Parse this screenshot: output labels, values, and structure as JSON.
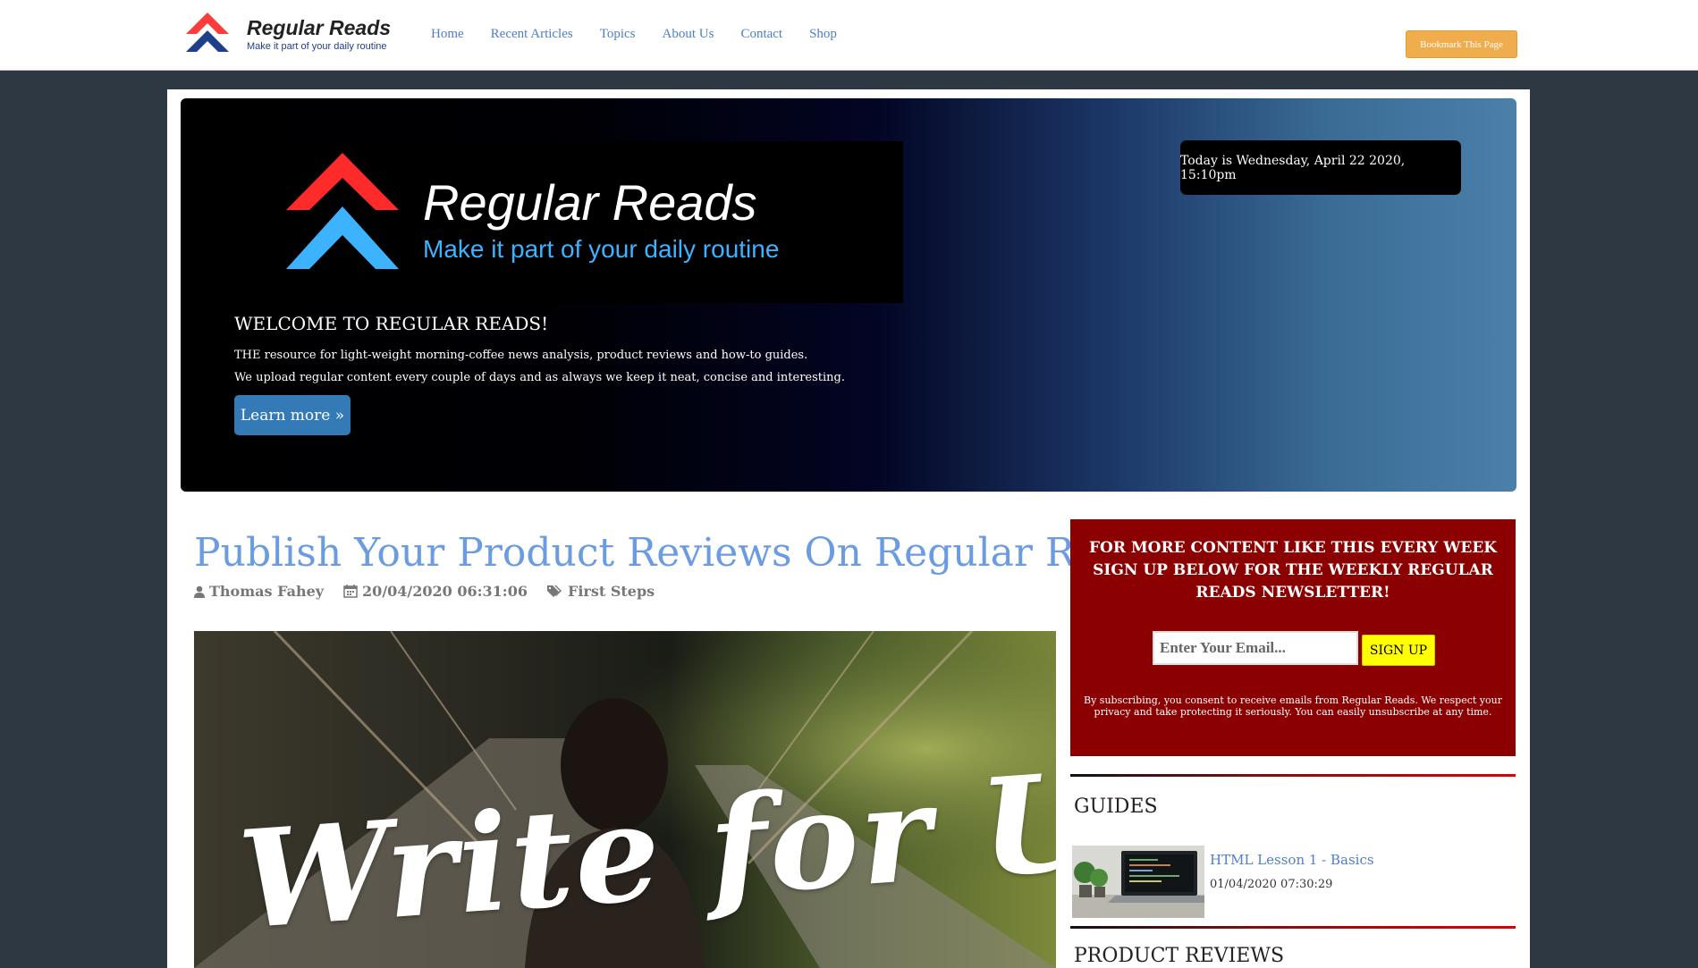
{
  "nav": {
    "brand_title": "Regular Reads",
    "brand_tagline": "Make it part of your daily routine",
    "links": [
      "Home",
      "Recent Articles",
      "Topics",
      "About Us",
      "Contact",
      "Shop"
    ],
    "bookmark_label": "Bookmark This Page"
  },
  "hero": {
    "logo_title": "Regular Reads",
    "logo_tagline": "Make it part of your daily routine",
    "date_text": "Today is Wednesday, April 22 2020, 15:10pm",
    "heading": "WELCOME TO REGULAR READS!",
    "line1": "THE resource for light-weight morning-coffee news analysis, product reviews and how-to guides.",
    "line2": "We upload regular content every couple of days and as always we keep it neat, concise and interesting.",
    "cta_label": "Learn more »"
  },
  "article": {
    "title": "Publish Your Product Reviews On Regular Reads",
    "author": "Thomas Fahey",
    "date": "20/04/2020 06:31:06",
    "category": "First Steps",
    "image_text": "Write for Us"
  },
  "newsletter": {
    "heading": "FOR MORE CONTENT LIKE THIS EVERY WEEK SIGN UP BELOW FOR THE WEEKLY REGULAR READS NEWSLETTER!",
    "email_placeholder": "Enter Your Email...",
    "signup_label": "SIGN UP",
    "consent": "By subscribing, you consent to receive emails from Regular Reads. We respect your privacy and take protecting it seriously. You can easily unsubscribe at any time."
  },
  "guides": {
    "heading": "GUIDES",
    "items": [
      {
        "title": "HTML Lesson 1 - Basics",
        "date": "01/04/2020 07:30:29"
      }
    ]
  },
  "product_reviews": {
    "heading": "PRODUCT REVIEWS"
  },
  "colors": {
    "link_blue": "#4e7ec7",
    "newsletter_red": "#8b0000",
    "bookmark_orange": "#f0ad4e",
    "cta_blue": "#337ab7",
    "signup_yellow": "#ffff00",
    "logo_red": "#ff2a2a",
    "logo_blue": "#3db2ff"
  }
}
